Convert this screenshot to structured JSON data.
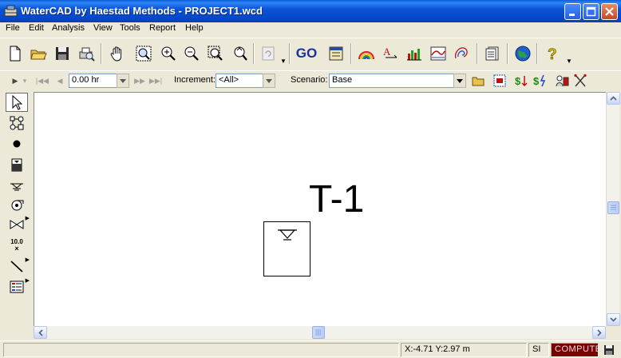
{
  "window": {
    "title": "WaterCAD by Haestad Methods - PROJECT1.wcd",
    "icon": "watercad-app-icon",
    "controls": [
      "minimize-icon",
      "maximize-icon",
      "close-icon"
    ]
  },
  "menu": {
    "items": [
      "File",
      "Edit",
      "Analysis",
      "View",
      "Tools",
      "Report",
      "Help"
    ]
  },
  "toolbar": {
    "go_label": "GO",
    "icons": [
      "new-file-icon",
      "open-folder-icon",
      "save-icon",
      "print-preview-icon",
      "pan-hand-icon",
      "zoom-extents-icon",
      "zoom-in-icon",
      "zoom-out-icon",
      "zoom-window-icon",
      "zoom-previous-icon",
      "refresh-icon",
      "go-compute-button",
      "profile-icon",
      "color-coding-icon",
      "annotation-icon",
      "graph-icon",
      "profile-graph-icon",
      "contour-icon",
      "report-icon",
      "globe-icon",
      "help-icon"
    ]
  },
  "time_bar": {
    "time_value": "0.00 hr",
    "increment_label": "Increment:",
    "increment_value": "<All>",
    "scenario_label": "Scenario:",
    "scenario_value": "Base"
  },
  "palette": {
    "tools": [
      "select-arrow-icon",
      "layout-pipe-icon",
      "junction-icon",
      "tank-icon",
      "reservoir-icon",
      "pump-icon",
      "valve-icon",
      "label-annotation-icon",
      "line-icon",
      "legend-icon"
    ],
    "label_tool_text_top": "10.0",
    "label_tool_text_bottom": "×"
  },
  "canvas": {
    "tank_label": "T-1"
  },
  "status": {
    "coordinates": "X:-4.71  Y:2.97 m",
    "units": "SI",
    "compute": "COMPUTE"
  },
  "colors": {
    "titlebar": "#0a55d6",
    "compute_bg": "#7a0000",
    "go_text": "#1a2fa0"
  }
}
